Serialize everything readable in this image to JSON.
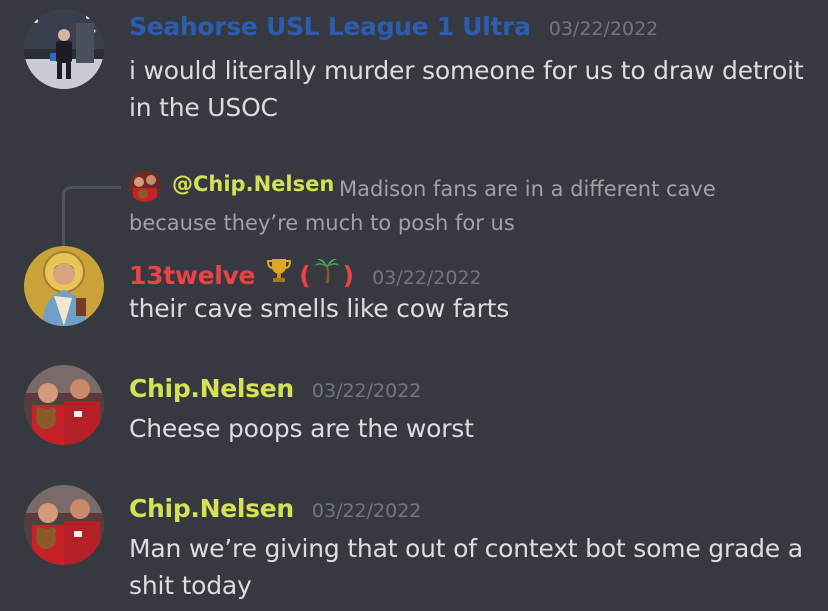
{
  "colors": {
    "background": "#36393f",
    "name_blue": "#2a5db0",
    "name_red": "#ed4245",
    "name_lime": "#d4e157",
    "timestamp": "#72767d",
    "text": "#dcddde"
  },
  "messages": [
    {
      "username": "Seahorse USL League 1 Ultra",
      "timestamp": "03/22/2022",
      "text": "i would literally murder someone for us to draw detroit in the USOC",
      "avatar": "snowy-street-photo-avatar"
    },
    {
      "reply": {
        "mention": "@Chip.Nelsen",
        "text": "Madison fans are in a different cave because they’re much to posh for us"
      },
      "username": "13twelve",
      "badges": {
        "trophy": "trophy-icon",
        "open": "(",
        "palm": "palm-tree-icon",
        "close": ")"
      },
      "timestamp": "03/22/2022",
      "text": "their cave smells like cow farts",
      "avatar": "saint-icon-avatar"
    },
    {
      "username": "Chip.Nelsen",
      "timestamp": "03/22/2022",
      "text": "Cheese poops are the worst",
      "avatar": "stadium-fans-avatar"
    },
    {
      "username": "Chip.Nelsen",
      "timestamp": "03/22/2022",
      "text": "Man we’re giving that out of context bot some grade a shit today",
      "avatar": "stadium-fans-avatar"
    }
  ]
}
